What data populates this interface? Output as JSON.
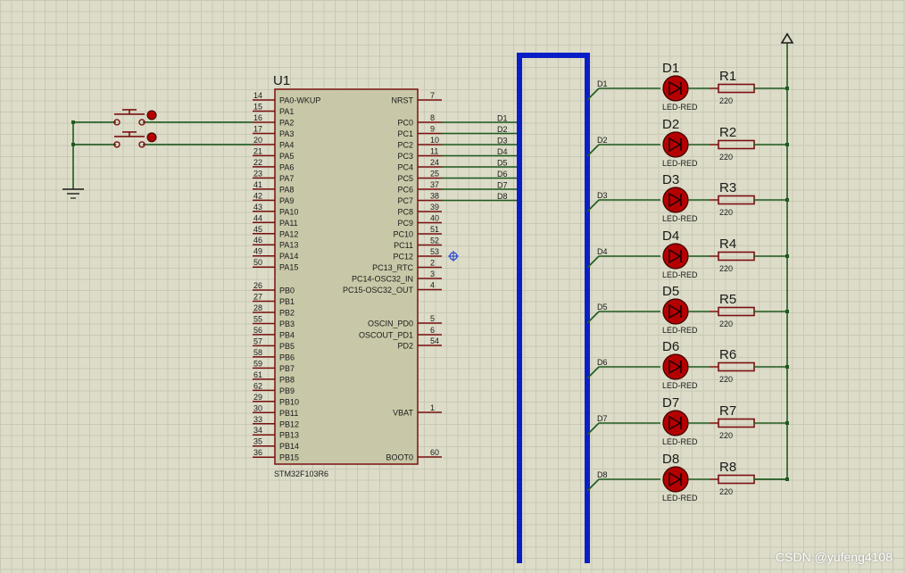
{
  "chip": {
    "ref": "U1",
    "part": "STM32F103R6",
    "left_pins": [
      {
        "num": "14",
        "name": "PA0-WKUP"
      },
      {
        "num": "15",
        "name": "PA1"
      },
      {
        "num": "16",
        "name": "PA2"
      },
      {
        "num": "17",
        "name": "PA3"
      },
      {
        "num": "20",
        "name": "PA4"
      },
      {
        "num": "21",
        "name": "PA5"
      },
      {
        "num": "22",
        "name": "PA6"
      },
      {
        "num": "23",
        "name": "PA7"
      },
      {
        "num": "41",
        "name": "PA8"
      },
      {
        "num": "42",
        "name": "PA9"
      },
      {
        "num": "43",
        "name": "PA10"
      },
      {
        "num": "44",
        "name": "PA11"
      },
      {
        "num": "45",
        "name": "PA12"
      },
      {
        "num": "46",
        "name": "PA13"
      },
      {
        "num": "49",
        "name": "PA14"
      },
      {
        "num": "50",
        "name": "PA15"
      },
      {
        "num": "26",
        "name": "PB0"
      },
      {
        "num": "27",
        "name": "PB1"
      },
      {
        "num": "28",
        "name": "PB2"
      },
      {
        "num": "55",
        "name": "PB3"
      },
      {
        "num": "56",
        "name": "PB4"
      },
      {
        "num": "57",
        "name": "PB5"
      },
      {
        "num": "58",
        "name": "PB6"
      },
      {
        "num": "59",
        "name": "PB7"
      },
      {
        "num": "61",
        "name": "PB8"
      },
      {
        "num": "62",
        "name": "PB9"
      },
      {
        "num": "29",
        "name": "PB10"
      },
      {
        "num": "30",
        "name": "PB11"
      },
      {
        "num": "33",
        "name": "PB12"
      },
      {
        "num": "34",
        "name": "PB13"
      },
      {
        "num": "35",
        "name": "PB14"
      },
      {
        "num": "36",
        "name": "PB15"
      }
    ],
    "right_pins": [
      {
        "num": "7",
        "name": "NRST"
      },
      {
        "num": "8",
        "name": "PC0"
      },
      {
        "num": "9",
        "name": "PC1"
      },
      {
        "num": "10",
        "name": "PC2"
      },
      {
        "num": "11",
        "name": "PC3"
      },
      {
        "num": "24",
        "name": "PC4"
      },
      {
        "num": "25",
        "name": "PC5"
      },
      {
        "num": "37",
        "name": "PC6"
      },
      {
        "num": "38",
        "name": "PC7"
      },
      {
        "num": "39",
        "name": "PC8"
      },
      {
        "num": "40",
        "name": "PC9"
      },
      {
        "num": "51",
        "name": "PC10"
      },
      {
        "num": "52",
        "name": "PC11"
      },
      {
        "num": "53",
        "name": "PC12"
      },
      {
        "num": "2",
        "name": "PC13_RTC"
      },
      {
        "num": "3",
        "name": "PC14-OSC32_IN"
      },
      {
        "num": "4",
        "name": "PC15-OSC32_OUT"
      },
      {
        "num": "5",
        "name": "OSCIN_PD0"
      },
      {
        "num": "6",
        "name": "OSCOUT_PD1"
      },
      {
        "num": "54",
        "name": "PD2"
      },
      {
        "num": "1",
        "name": "VBAT"
      },
      {
        "num": "60",
        "name": "BOOT0"
      }
    ]
  },
  "net_labels": [
    "D1",
    "D2",
    "D3",
    "D4",
    "D5",
    "D6",
    "D7",
    "D8"
  ],
  "leds": [
    {
      "ref": "D1",
      "type": "LED-RED"
    },
    {
      "ref": "D2",
      "type": "LED-RED"
    },
    {
      "ref": "D3",
      "type": "LED-RED"
    },
    {
      "ref": "D4",
      "type": "LED-RED"
    },
    {
      "ref": "D5",
      "type": "LED-RED"
    },
    {
      "ref": "D6",
      "type": "LED-RED"
    },
    {
      "ref": "D7",
      "type": "LED-RED"
    },
    {
      "ref": "D8",
      "type": "LED-RED"
    }
  ],
  "resistors": [
    {
      "ref": "R1",
      "value": "220"
    },
    {
      "ref": "R2",
      "value": "220"
    },
    {
      "ref": "R3",
      "value": "220"
    },
    {
      "ref": "R4",
      "value": "220"
    },
    {
      "ref": "R5",
      "value": "220"
    },
    {
      "ref": "R6",
      "value": "220"
    },
    {
      "ref": "R7",
      "value": "220"
    },
    {
      "ref": "R8",
      "value": "220"
    }
  ],
  "watermark": "CSDN @yufeng4108",
  "colors": {
    "background": "#dcdcc8",
    "grid": "#c8c8b4",
    "chip_fill": "#c8c8a8",
    "chip_border": "#7a1010",
    "wire": "#1f5a1f",
    "bus": "#0a1ec8",
    "led": "#b40000",
    "component": "#7a1010"
  }
}
